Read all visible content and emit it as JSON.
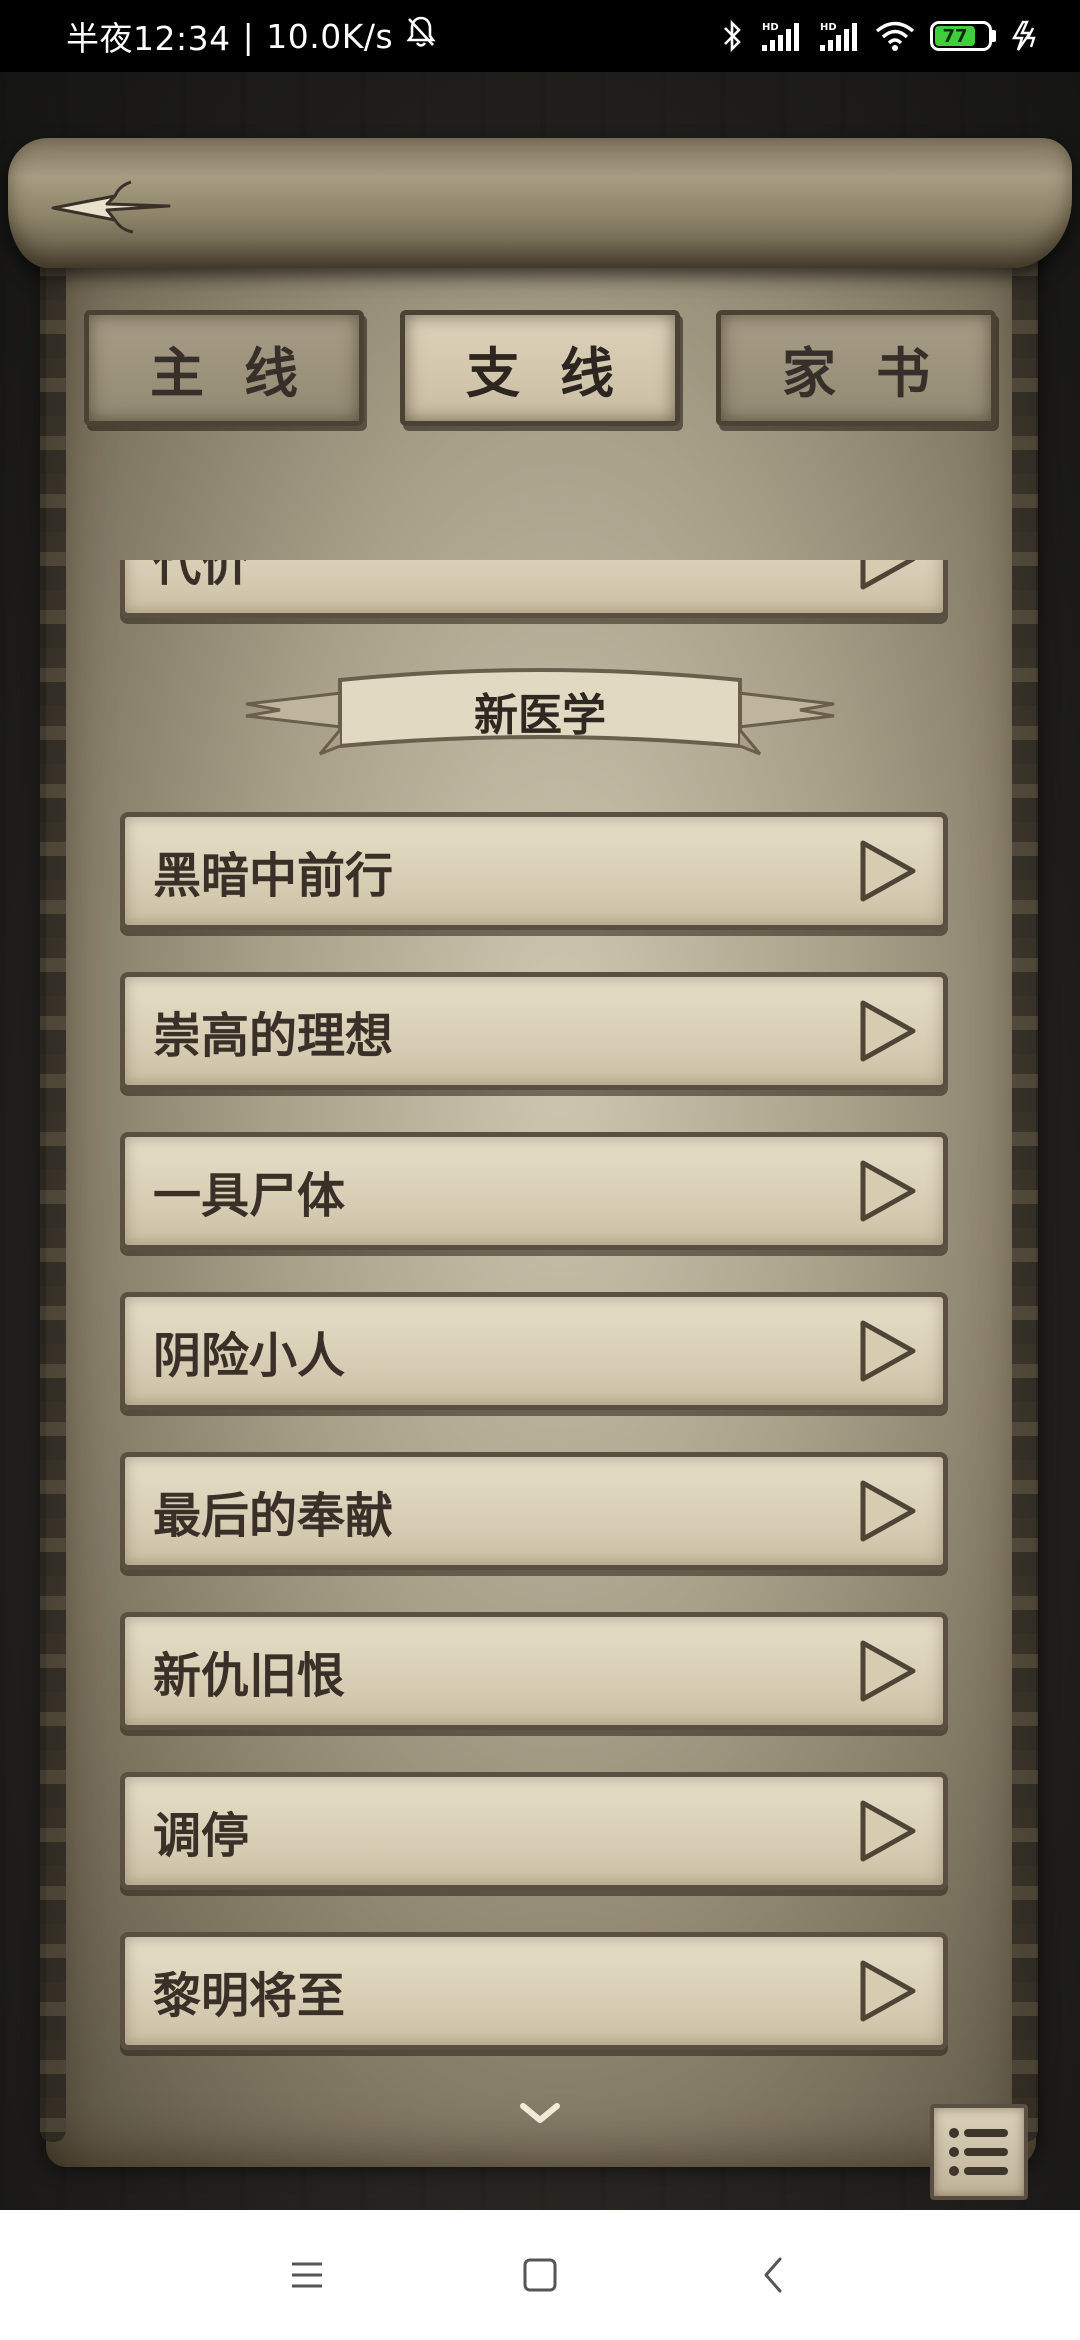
{
  "status_bar": {
    "time": "半夜12:34",
    "separator": "|",
    "net_speed": "10.0K/s",
    "battery": "77",
    "icons": [
      "mute-bell-icon",
      "bluetooth-icon",
      "signal-hd-icon",
      "signal-hd-icon",
      "wifi-icon",
      "battery-icon",
      "charging-icon"
    ],
    "battery_color": "#3fcf3a"
  },
  "header": {
    "back_icon": "arrow-back-icon"
  },
  "tabs": [
    {
      "label": "主线",
      "active": false
    },
    {
      "label": "支线",
      "active": true
    },
    {
      "label": "家书",
      "active": false
    }
  ],
  "list": {
    "partial_item": "代价",
    "section_title": "新医学",
    "items": [
      {
        "label": "黑暗中前行"
      },
      {
        "label": "崇高的理想"
      },
      {
        "label": "一具尸体"
      },
      {
        "label": "阴险小人"
      },
      {
        "label": "最后的奉献"
      },
      {
        "label": "新仇旧恨"
      },
      {
        "label": "调停"
      },
      {
        "label": "黎明将至"
      }
    ]
  },
  "controls": {
    "scroll_icon": "chevron-down-icon",
    "menu_icon": "list-menu-icon"
  },
  "nav_bar": {
    "icons": [
      "menu-lines-icon",
      "home-square-icon",
      "back-chevron-icon"
    ]
  }
}
